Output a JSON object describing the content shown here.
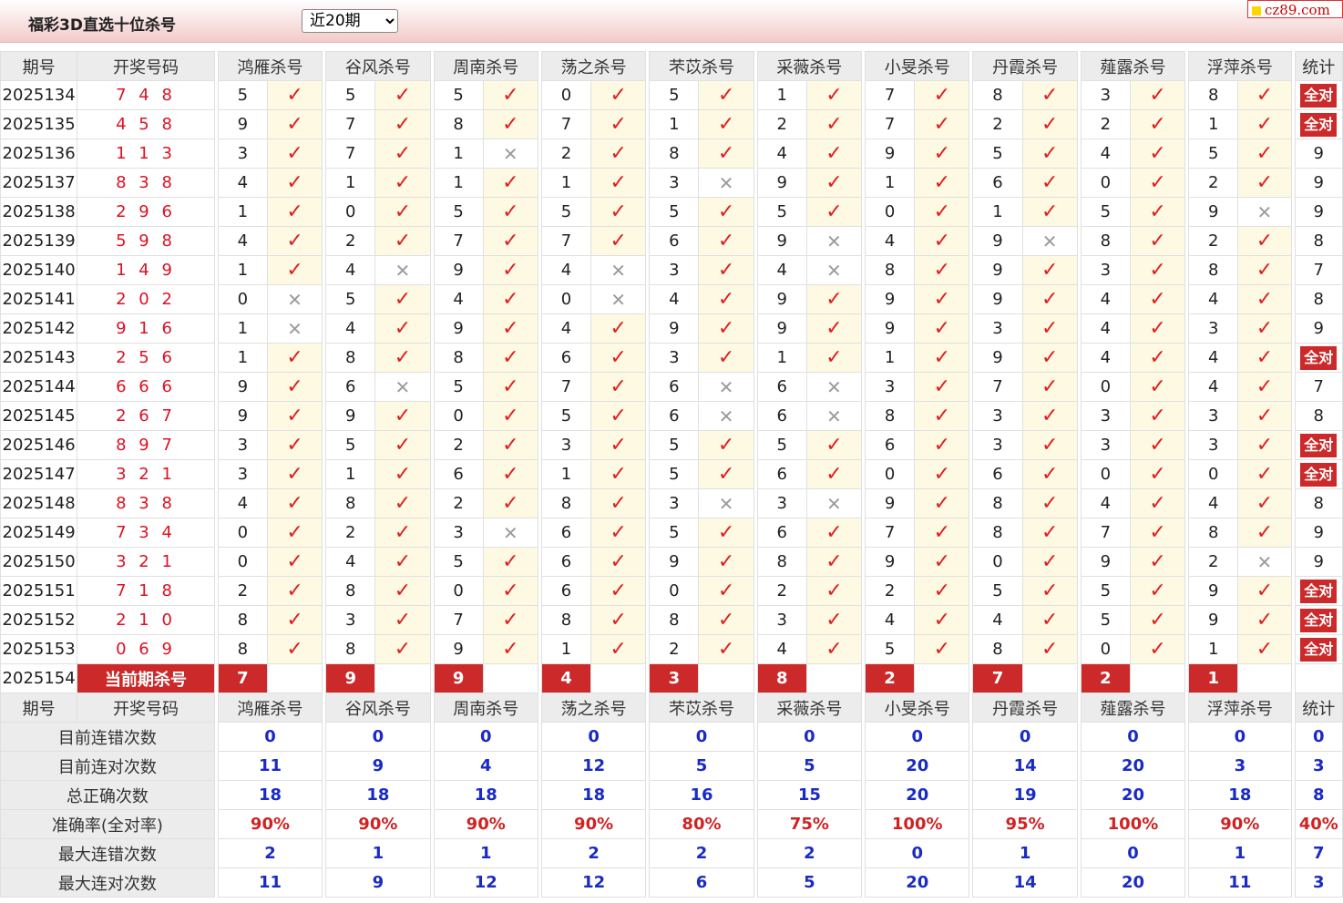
{
  "header": {
    "title": "福彩3D直选十位杀号",
    "period_option": "近20期",
    "site_logo": "cz89.com"
  },
  "columns": {
    "issue": "期号",
    "draw": "开奖号码",
    "experts": [
      "鸿雁杀号",
      "谷风杀号",
      "周南杀号",
      "荡之杀号",
      "芣苡杀号",
      "采薇杀号",
      "小旻杀号",
      "丹霞杀号",
      "薤露杀号",
      "浮萍杀号"
    ],
    "stat": "统计"
  },
  "rows": [
    {
      "issue": "2025134",
      "draw": "7 4 8",
      "kills": [
        "5",
        "5",
        "5",
        "0",
        "5",
        "1",
        "7",
        "8",
        "3",
        "8"
      ],
      "hits": [
        1,
        1,
        1,
        1,
        1,
        1,
        1,
        1,
        1,
        1
      ],
      "stat": "全对"
    },
    {
      "issue": "2025135",
      "draw": "4 5 8",
      "kills": [
        "9",
        "7",
        "8",
        "7",
        "1",
        "2",
        "7",
        "2",
        "2",
        "1"
      ],
      "hits": [
        1,
        1,
        1,
        1,
        1,
        1,
        1,
        1,
        1,
        1
      ],
      "stat": "全对"
    },
    {
      "issue": "2025136",
      "draw": "1 1 3",
      "kills": [
        "3",
        "7",
        "1",
        "2",
        "8",
        "4",
        "9",
        "5",
        "4",
        "5"
      ],
      "hits": [
        1,
        1,
        0,
        1,
        1,
        1,
        1,
        1,
        1,
        1
      ],
      "stat": "9"
    },
    {
      "issue": "2025137",
      "draw": "8 3 8",
      "kills": [
        "4",
        "1",
        "1",
        "1",
        "3",
        "9",
        "1",
        "6",
        "0",
        "2"
      ],
      "hits": [
        1,
        1,
        1,
        1,
        0,
        1,
        1,
        1,
        1,
        1
      ],
      "stat": "9"
    },
    {
      "issue": "2025138",
      "draw": "2 9 6",
      "kills": [
        "1",
        "0",
        "5",
        "5",
        "5",
        "5",
        "0",
        "1",
        "5",
        "9"
      ],
      "hits": [
        1,
        1,
        1,
        1,
        1,
        1,
        1,
        1,
        1,
        0
      ],
      "stat": "9"
    },
    {
      "issue": "2025139",
      "draw": "5 9 8",
      "kills": [
        "4",
        "2",
        "7",
        "7",
        "6",
        "9",
        "4",
        "9",
        "8",
        "2"
      ],
      "hits": [
        1,
        1,
        1,
        1,
        1,
        0,
        1,
        0,
        1,
        1
      ],
      "stat": "8"
    },
    {
      "issue": "2025140",
      "draw": "1 4 9",
      "kills": [
        "1",
        "4",
        "9",
        "4",
        "3",
        "4",
        "8",
        "9",
        "3",
        "8"
      ],
      "hits": [
        1,
        0,
        1,
        0,
        1,
        0,
        1,
        1,
        1,
        1
      ],
      "stat": "7"
    },
    {
      "issue": "2025141",
      "draw": "2 0 2",
      "kills": [
        "0",
        "5",
        "4",
        "0",
        "4",
        "9",
        "9",
        "9",
        "4",
        "4"
      ],
      "hits": [
        0,
        1,
        1,
        0,
        1,
        1,
        1,
        1,
        1,
        1
      ],
      "stat": "8"
    },
    {
      "issue": "2025142",
      "draw": "9 1 6",
      "kills": [
        "1",
        "4",
        "9",
        "4",
        "9",
        "9",
        "9",
        "3",
        "4",
        "3"
      ],
      "hits": [
        0,
        1,
        1,
        1,
        1,
        1,
        1,
        1,
        1,
        1
      ],
      "stat": "9"
    },
    {
      "issue": "2025143",
      "draw": "2 5 6",
      "kills": [
        "1",
        "8",
        "8",
        "6",
        "3",
        "1",
        "1",
        "9",
        "4",
        "4"
      ],
      "hits": [
        1,
        1,
        1,
        1,
        1,
        1,
        1,
        1,
        1,
        1
      ],
      "stat": "全对"
    },
    {
      "issue": "2025144",
      "draw": "6 6 6",
      "kills": [
        "9",
        "6",
        "5",
        "7",
        "6",
        "6",
        "3",
        "7",
        "0",
        "4"
      ],
      "hits": [
        1,
        0,
        1,
        1,
        0,
        0,
        1,
        1,
        1,
        1
      ],
      "stat": "7"
    },
    {
      "issue": "2025145",
      "draw": "2 6 7",
      "kills": [
        "9",
        "9",
        "0",
        "5",
        "6",
        "6",
        "8",
        "3",
        "3",
        "3"
      ],
      "hits": [
        1,
        1,
        1,
        1,
        0,
        0,
        1,
        1,
        1,
        1
      ],
      "stat": "8"
    },
    {
      "issue": "2025146",
      "draw": "8 9 7",
      "kills": [
        "3",
        "5",
        "2",
        "3",
        "5",
        "5",
        "6",
        "3",
        "3",
        "3"
      ],
      "hits": [
        1,
        1,
        1,
        1,
        1,
        1,
        1,
        1,
        1,
        1
      ],
      "stat": "全对"
    },
    {
      "issue": "2025147",
      "draw": "3 2 1",
      "kills": [
        "3",
        "1",
        "6",
        "1",
        "5",
        "6",
        "0",
        "6",
        "0",
        "0"
      ],
      "hits": [
        1,
        1,
        1,
        1,
        1,
        1,
        1,
        1,
        1,
        1
      ],
      "stat": "全对"
    },
    {
      "issue": "2025148",
      "draw": "8 3 8",
      "kills": [
        "4",
        "8",
        "2",
        "8",
        "3",
        "3",
        "9",
        "8",
        "4",
        "4"
      ],
      "hits": [
        1,
        1,
        1,
        1,
        0,
        0,
        1,
        1,
        1,
        1
      ],
      "stat": "8"
    },
    {
      "issue": "2025149",
      "draw": "7 3 4",
      "kills": [
        "0",
        "2",
        "3",
        "6",
        "5",
        "6",
        "7",
        "8",
        "7",
        "8"
      ],
      "hits": [
        1,
        1,
        0,
        1,
        1,
        1,
        1,
        1,
        1,
        1
      ],
      "stat": "9"
    },
    {
      "issue": "2025150",
      "draw": "3 2 1",
      "kills": [
        "0",
        "4",
        "5",
        "6",
        "9",
        "8",
        "9",
        "0",
        "9",
        "2"
      ],
      "hits": [
        1,
        1,
        1,
        1,
        1,
        1,
        1,
        1,
        1,
        0
      ],
      "stat": "9"
    },
    {
      "issue": "2025151",
      "draw": "7 1 8",
      "kills": [
        "2",
        "8",
        "0",
        "6",
        "0",
        "2",
        "2",
        "5",
        "5",
        "9"
      ],
      "hits": [
        1,
        1,
        1,
        1,
        1,
        1,
        1,
        1,
        1,
        1
      ],
      "stat": "全对"
    },
    {
      "issue": "2025152",
      "draw": "2 1 0",
      "kills": [
        "8",
        "3",
        "7",
        "8",
        "8",
        "3",
        "4",
        "4",
        "5",
        "9"
      ],
      "hits": [
        1,
        1,
        1,
        1,
        1,
        1,
        1,
        1,
        1,
        1
      ],
      "stat": "全对"
    },
    {
      "issue": "2025153",
      "draw": "0 6 9",
      "kills": [
        "8",
        "8",
        "9",
        "1",
        "2",
        "4",
        "5",
        "8",
        "0",
        "1"
      ],
      "hits": [
        1,
        1,
        1,
        1,
        1,
        1,
        1,
        1,
        1,
        1
      ],
      "stat": "全对"
    }
  ],
  "current": {
    "issue": "2025154",
    "label": "当前期杀号",
    "kills": [
      "7",
      "9",
      "9",
      "4",
      "3",
      "8",
      "2",
      "7",
      "2",
      "1"
    ]
  },
  "summary": [
    {
      "label": "目前连错次数",
      "values": [
        "0",
        "0",
        "0",
        "0",
        "0",
        "0",
        "0",
        "0",
        "0",
        "0"
      ],
      "stat": "0",
      "color": "blue"
    },
    {
      "label": "目前连对次数",
      "values": [
        "11",
        "9",
        "4",
        "12",
        "5",
        "5",
        "20",
        "14",
        "20",
        "3"
      ],
      "stat": "3",
      "color": "blue"
    },
    {
      "label": "总正确次数",
      "values": [
        "18",
        "18",
        "18",
        "18",
        "16",
        "15",
        "20",
        "19",
        "20",
        "18"
      ],
      "stat": "8",
      "color": "blue"
    },
    {
      "label": "准确率(全对率)",
      "values": [
        "90%",
        "90%",
        "90%",
        "90%",
        "80%",
        "75%",
        "100%",
        "95%",
        "100%",
        "90%"
      ],
      "stat": "40%",
      "color": "red"
    },
    {
      "label": "最大连错次数",
      "values": [
        "2",
        "1",
        "1",
        "2",
        "2",
        "2",
        "0",
        "1",
        "0",
        "1"
      ],
      "stat": "7",
      "color": "blue"
    },
    {
      "label": "最大连对次数",
      "values": [
        "11",
        "9",
        "12",
        "12",
        "6",
        "5",
        "20",
        "14",
        "20",
        "11"
      ],
      "stat": "3",
      "color": "blue"
    }
  ],
  "glyphs": {
    "hit": "✓",
    "miss": "✕"
  },
  "colors": {
    "accent": "#cc2a2a",
    "draw_red": "#dd1122",
    "stat_blue": "#1a2bc4",
    "mark_bg": "#fdf9e3"
  }
}
